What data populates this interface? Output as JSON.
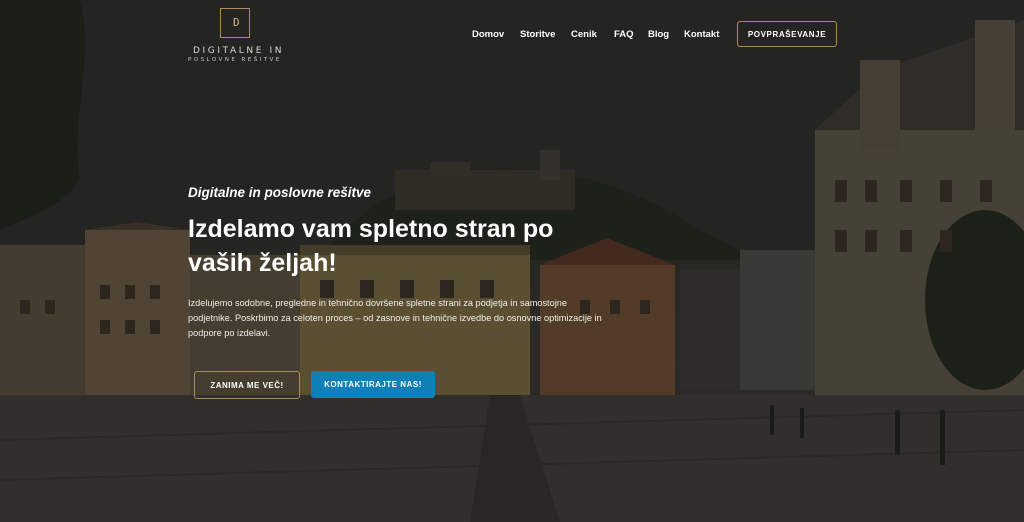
{
  "brand": {
    "logo_letter": "D",
    "name_line1": "DIGITALNE IN",
    "name_line2": "POSLOVNE REŠITVE",
    "accent_color": "#b08b5a"
  },
  "nav": {
    "items": [
      "Domov",
      "Storitve",
      "Cenik",
      "FAQ",
      "Blog",
      "Kontakt"
    ],
    "cta_label": "POVPRAŠEVANJE"
  },
  "hero": {
    "eyebrow": "Digitalne in poslovne rešitve",
    "headline": "Izdelamo vam spletno stran po vaših željah!",
    "lead": "Izdelujemo sodobne, pregledne in tehnično dovršene spletne strani za podjetja in samostojne podjetnike. Poskrbimo za celoten proces – od zasnove in tehnične izvedbe do osnovne optimizacije in podpore po izdelavi.",
    "button_more": "ZANIMA ME VEČ!",
    "button_contact": "KONTAKTIRAJTE NAS!",
    "contact_color": "#0f7fb8"
  }
}
